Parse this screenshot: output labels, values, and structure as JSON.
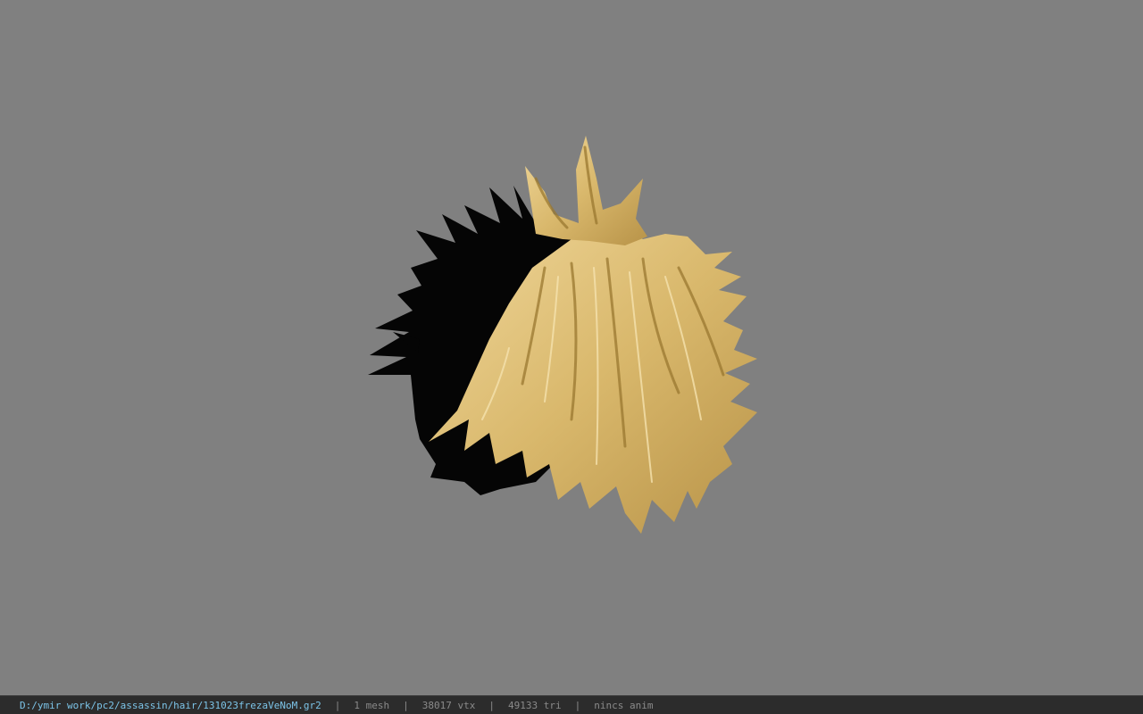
{
  "viewer": {
    "background_color": "#808080",
    "model_name": "hair mesh",
    "colors": {
      "shadow_side": "#050505",
      "blonde_light": "#e6c987",
      "blonde_mid": "#c9a75a",
      "blonde_dark": "#8f6f2c"
    }
  },
  "status": {
    "file_path": "D:/ymir work/pc2/assassin/hair/131023frezaVeNoM.gr2",
    "separator": "|",
    "mesh_count": "1 mesh",
    "vertex_count": "38017 vtx",
    "triangle_count": "49133 tri",
    "anim_info": "nincs anim",
    "path_color": "#7cc4e8",
    "text_color": "#8a8a8a"
  }
}
